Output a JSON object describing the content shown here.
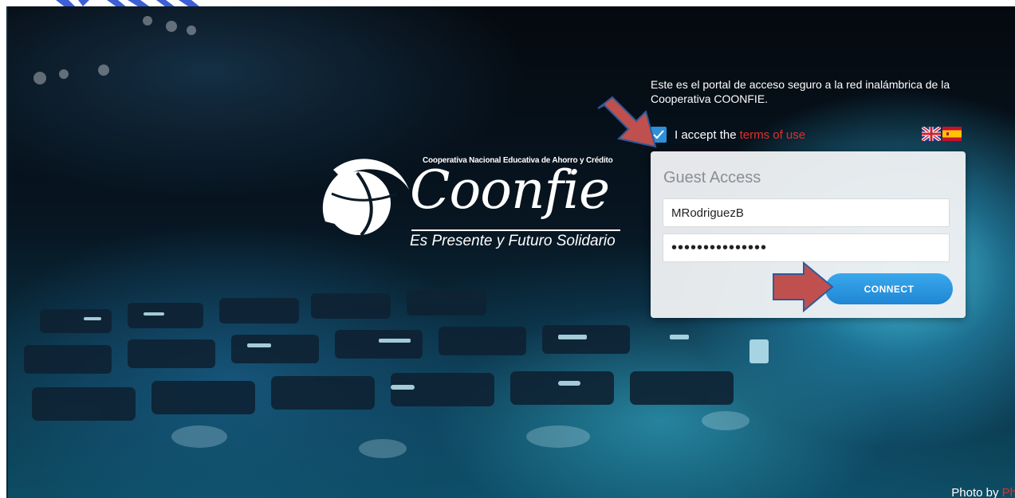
{
  "portal": {
    "intro_text": "Este es el portal de acceso seguro a la red inalámbrica de la Cooperativa COONFIE.",
    "accept_label": "I accept the",
    "terms_link": "terms of use",
    "accept_checked": true,
    "languages": [
      "english-flag-icon",
      "spanish-flag-icon"
    ]
  },
  "logo": {
    "org_name": "Cooperativa Nacional Educativa de Ahorro y Crédito",
    "wordmark": "Coonfie",
    "tagline": "Es Presente y Futuro Solidario"
  },
  "login": {
    "title": "Guest Access",
    "username_value": "MRodriguezB",
    "password_value": "•••••••••••••••",
    "connect_label": "CONNECT"
  },
  "footer": {
    "credit_prefix": "Photo by",
    "credit_link": "Ph"
  },
  "colors": {
    "accent": "#2f8fd8",
    "link_red": "#e0302c",
    "annotation_arrow": "#c0504d"
  }
}
